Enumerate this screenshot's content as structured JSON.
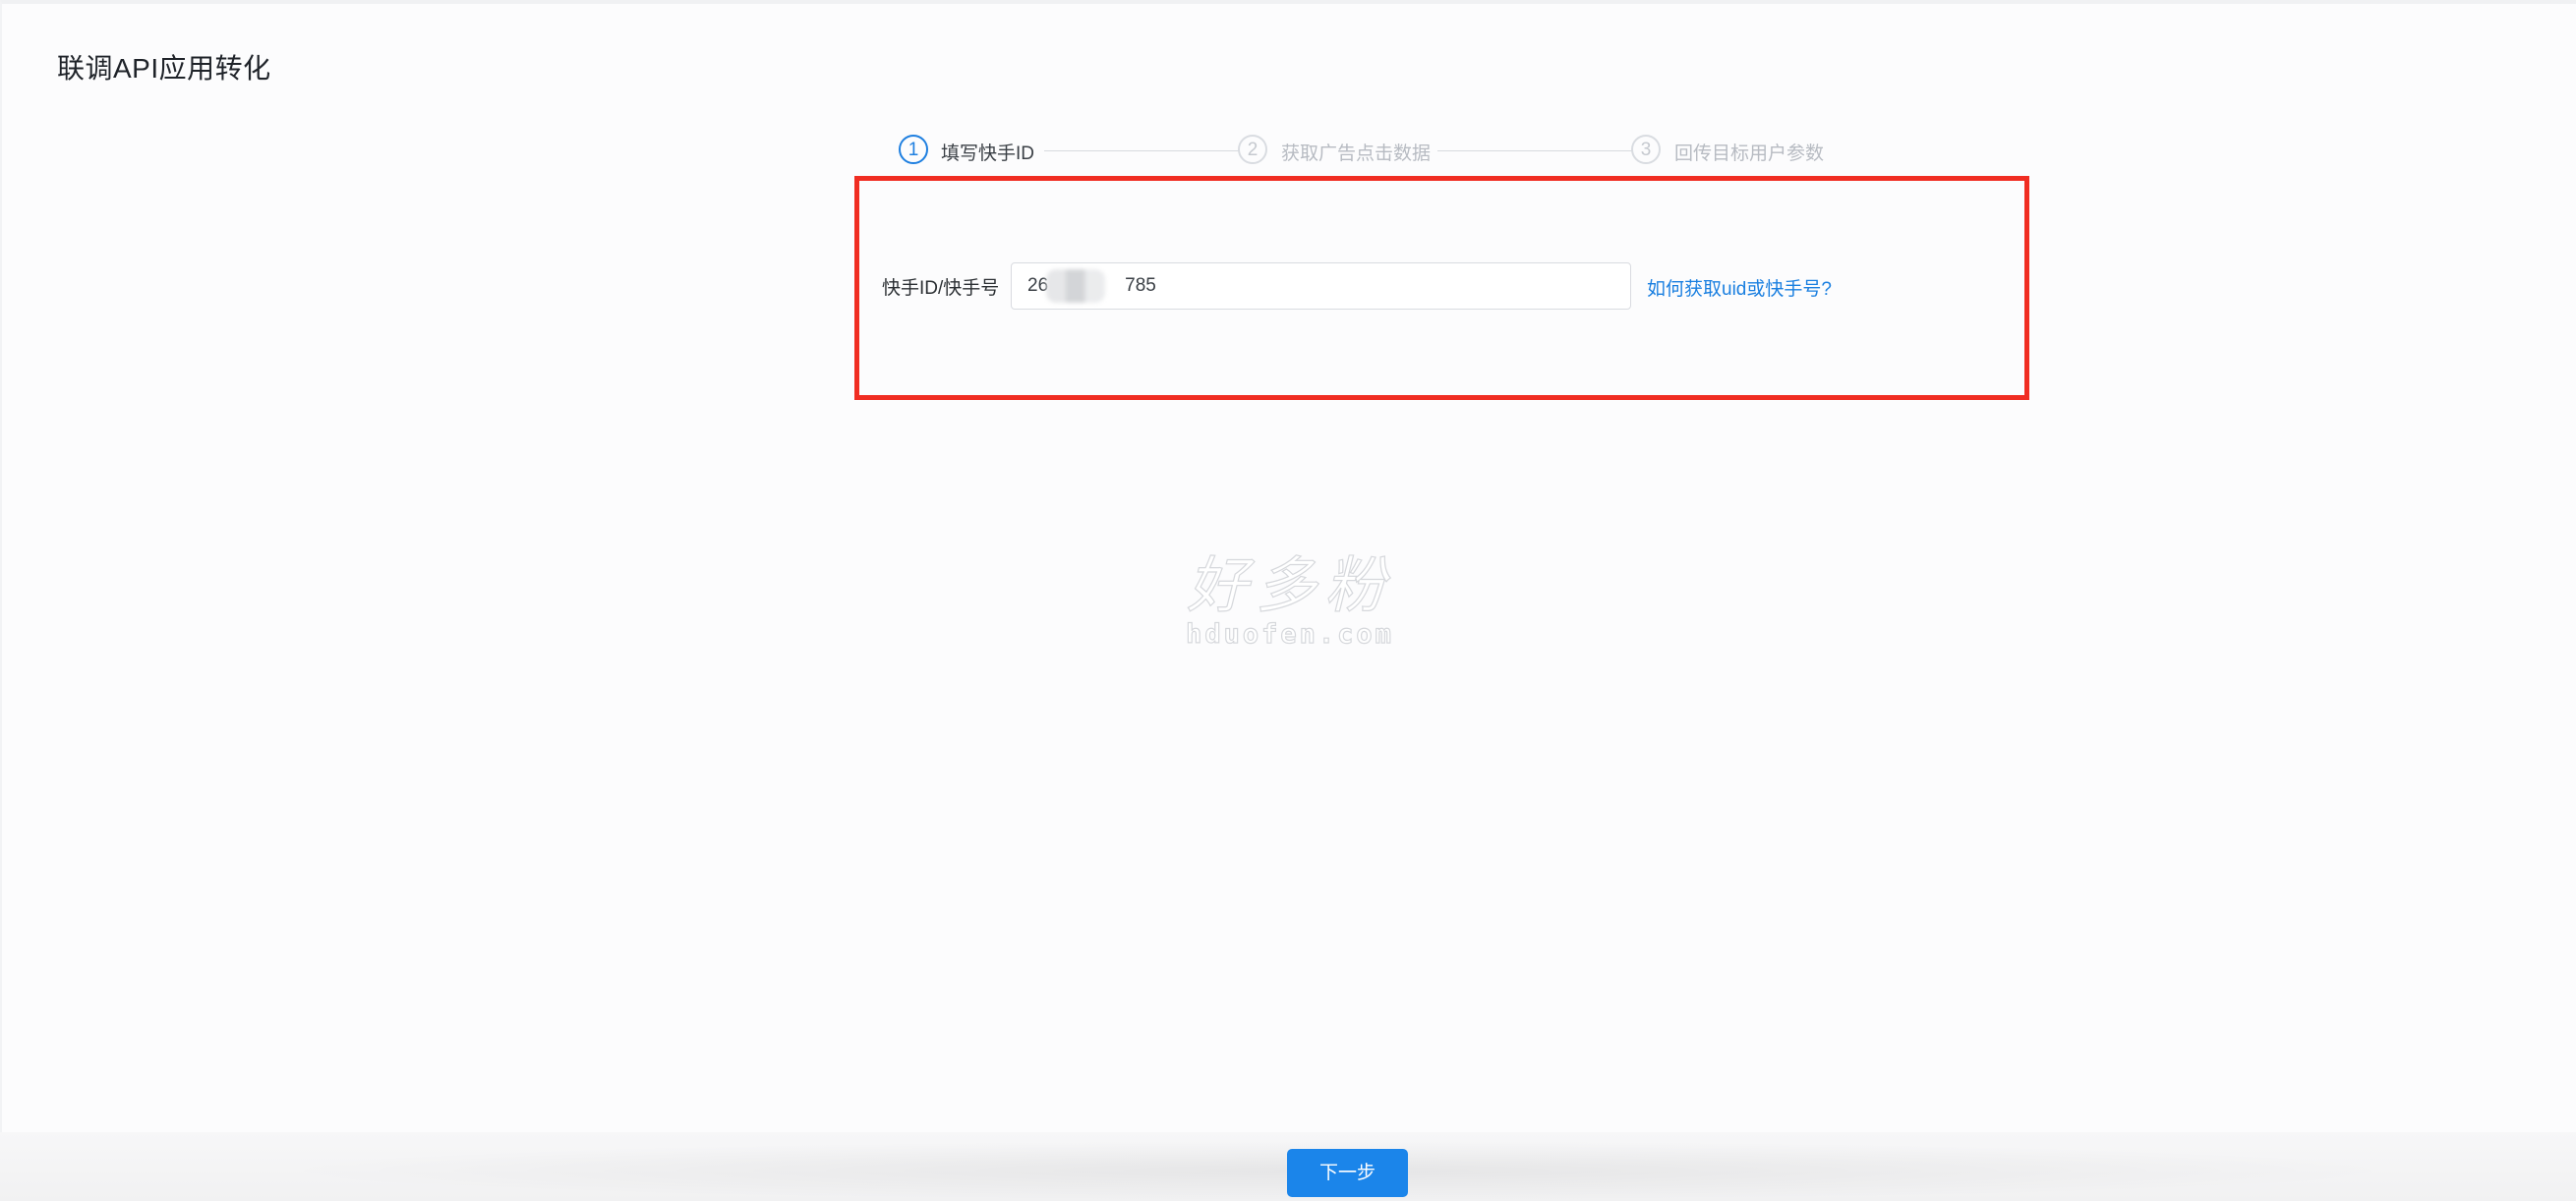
{
  "page": {
    "title": "联调API应用转化"
  },
  "steps": [
    {
      "number": "1",
      "label": "填写快手ID",
      "state": "active"
    },
    {
      "number": "2",
      "label": "获取广告点击数据",
      "state": "inactive"
    },
    {
      "number": "3",
      "label": "回传目标用户参数",
      "state": "inactive"
    }
  ],
  "form": {
    "label": "快手ID/快手号",
    "input_value_prefix": "26",
    "input_value_suffix": "785",
    "help_link": "如何获取uid或快手号?"
  },
  "watermark": {
    "cn": "好多粉",
    "en": "hduofen.com"
  },
  "footer": {
    "next_label": "下一步"
  },
  "colors": {
    "accent": "#1b85ea",
    "highlight": "#f02d22",
    "link": "#1a7fe0"
  }
}
